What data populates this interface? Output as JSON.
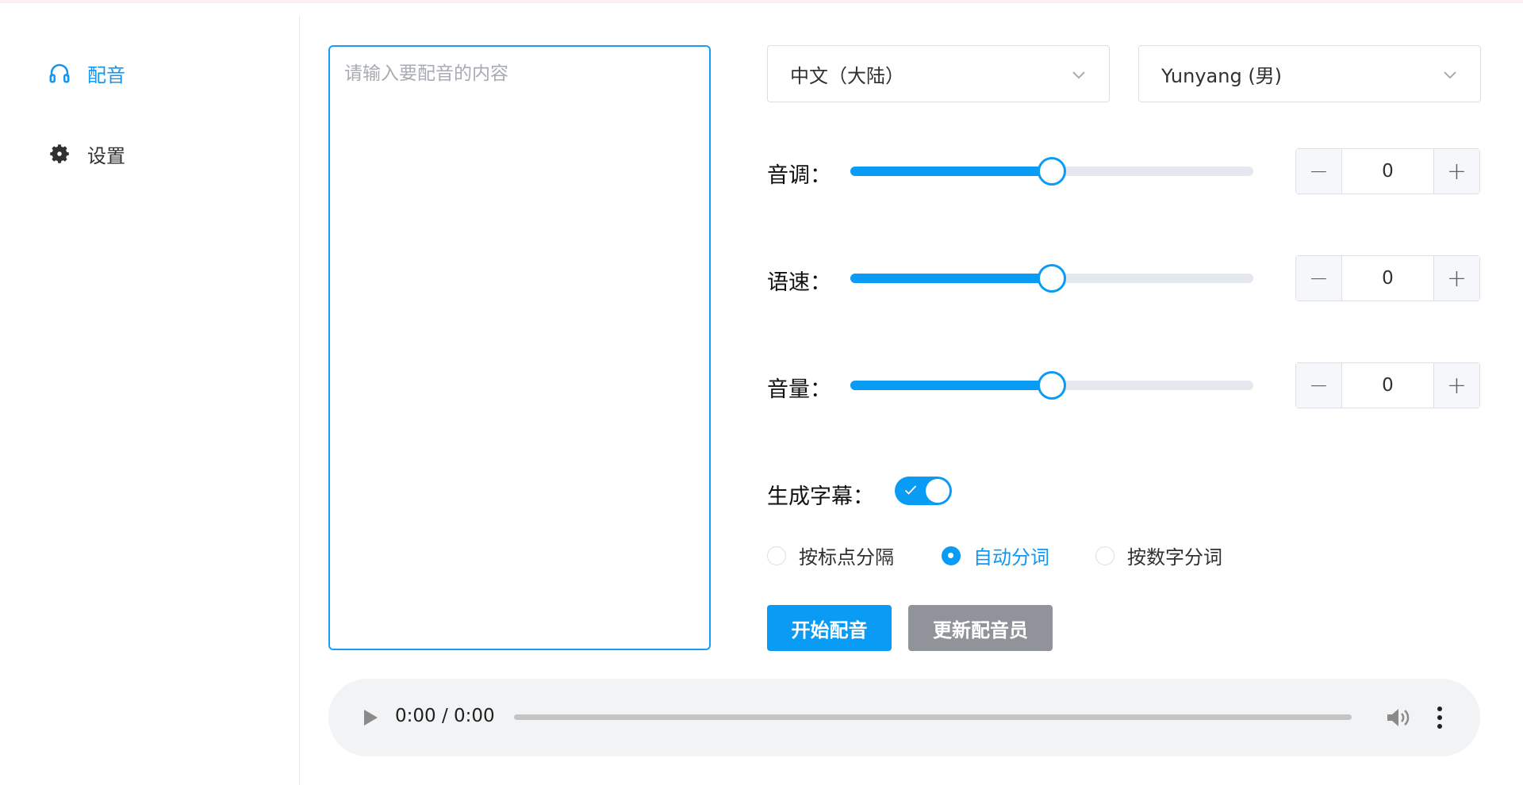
{
  "sidebar": {
    "items": [
      {
        "label": "配音",
        "icon": "headphones-icon",
        "active": true
      },
      {
        "label": "设置",
        "icon": "gear-icon",
        "active": false
      }
    ]
  },
  "editor": {
    "placeholder": "请输入要配音的内容",
    "value": ""
  },
  "selects": {
    "language": "中文（大陆）",
    "voice": "Yunyang (男)"
  },
  "sliders": [
    {
      "label": "音调：",
      "value": "0",
      "fraction": 0.5
    },
    {
      "label": "语速：",
      "value": "0",
      "fraction": 0.5
    },
    {
      "label": "音量：",
      "value": "0",
      "fraction": 0.5
    }
  ],
  "subtitles": {
    "label": "生成字幕：",
    "enabled": true,
    "options": [
      {
        "label": "按标点分隔",
        "checked": false
      },
      {
        "label": "自动分词",
        "checked": true
      },
      {
        "label": "按数字分词",
        "checked": false
      }
    ]
  },
  "actions": {
    "start_label": "开始配音",
    "update_label": "更新配音员"
  },
  "player": {
    "time": "0:00 / 0:00"
  },
  "colors": {
    "accent": "#0a9bf5",
    "gray_button": "#909399",
    "player_bg": "#f1f3f4"
  }
}
